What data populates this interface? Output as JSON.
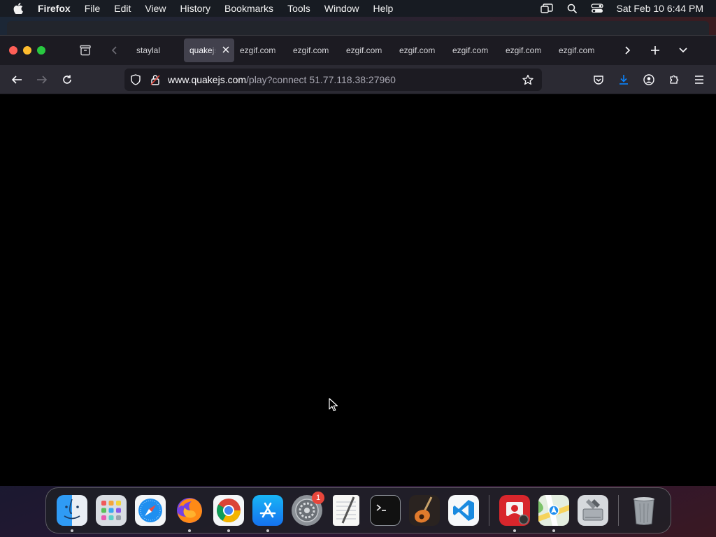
{
  "menubar": {
    "app_name": "Firefox",
    "menus": [
      "File",
      "Edit",
      "View",
      "History",
      "Bookmarks",
      "Tools",
      "Window",
      "Help"
    ],
    "clock": "Sat Feb 10  6:44 PM"
  },
  "tabs": [
    {
      "title": "staylal",
      "active": false
    },
    {
      "title": "quakejs",
      "active": true
    },
    {
      "title": "ezgif.com",
      "active": false
    },
    {
      "title": "ezgif.com",
      "active": false
    },
    {
      "title": "ezgif.com",
      "active": false
    },
    {
      "title": "ezgif.com",
      "active": false
    },
    {
      "title": "ezgif.com",
      "active": false
    },
    {
      "title": "ezgif.com",
      "active": false
    },
    {
      "title": "ezgif.com",
      "active": false
    }
  ],
  "url": {
    "host": "www.quakejs.com",
    "path": "/play?connect 51.77.118.38:27960"
  },
  "dock": {
    "apps": [
      {
        "name": "finder-icon",
        "running": true
      },
      {
        "name": "launchpad-icon",
        "running": false
      },
      {
        "name": "safari-icon",
        "running": false
      },
      {
        "name": "firefox-icon",
        "running": true
      },
      {
        "name": "chrome-icon",
        "running": true
      },
      {
        "name": "app-store-icon",
        "running": true
      },
      {
        "name": "system-settings-icon",
        "running": false,
        "badge": "1"
      },
      {
        "name": "textedit-icon",
        "running": false
      },
      {
        "name": "terminal-icon",
        "running": false
      },
      {
        "name": "garageband-icon",
        "running": false
      },
      {
        "name": "vscode-icon",
        "running": false
      },
      {
        "name": "photo-booth-icon",
        "running": true
      },
      {
        "name": "maps-icon",
        "running": true
      },
      {
        "name": "disk-utility-icon",
        "running": false
      },
      {
        "name": "trash-icon",
        "running": false
      }
    ]
  },
  "colors": {
    "accent_blue": "#0a84ff",
    "close": "#fe5f57",
    "minimize": "#febc2e",
    "maximize": "#28c840",
    "badge": "#e8463b"
  }
}
